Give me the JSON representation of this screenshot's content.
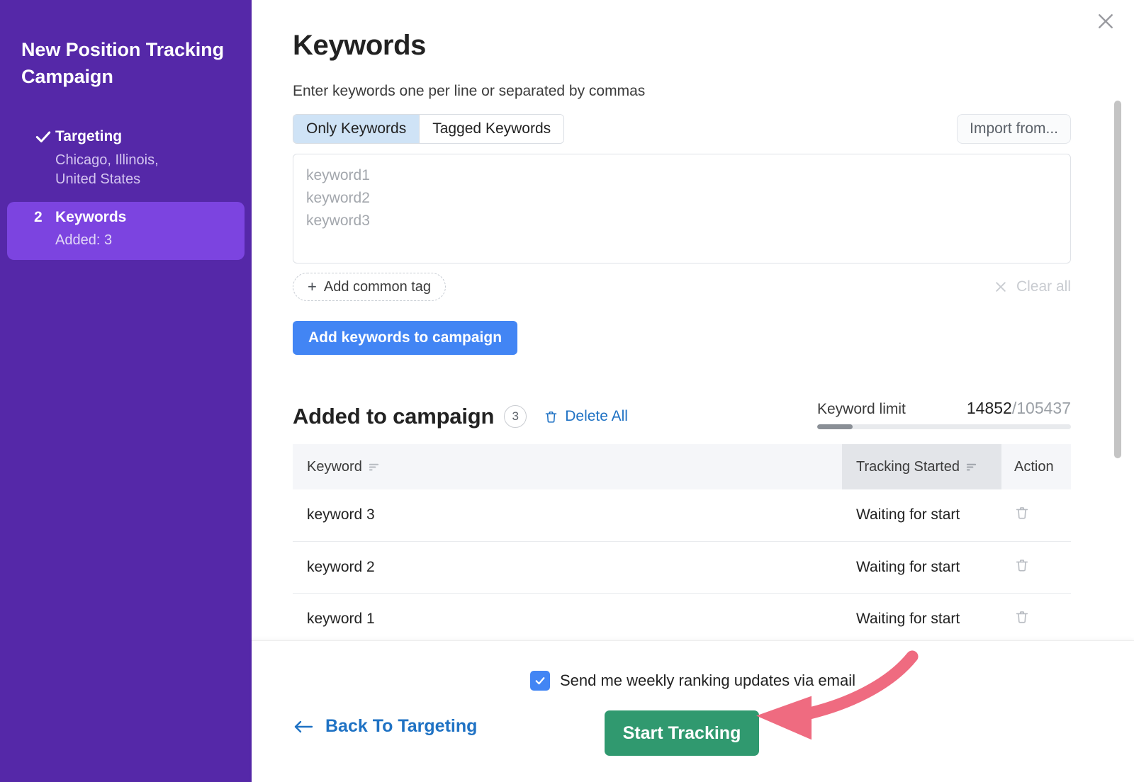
{
  "sidebar": {
    "title": "New Position Tracking Campaign",
    "steps": [
      {
        "marker": "check",
        "label": "Targeting",
        "sub": "Chicago, Illinois, United States",
        "active": false
      },
      {
        "marker": "2",
        "label": "Keywords",
        "sub": "Added: 3",
        "active": true
      }
    ]
  },
  "main": {
    "close_icon": "close-icon",
    "page_title": "Keywords",
    "subtitle": "Enter keywords one per line or separated by commas",
    "tabs": [
      {
        "label": "Only Keywords",
        "active": true
      },
      {
        "label": "Tagged Keywords",
        "active": false
      }
    ],
    "import_button": "Import from...",
    "textarea_placeholder": "keyword1\nkeyword2\nkeyword3",
    "textarea_value": "",
    "add_common_tag": "Add common tag",
    "add_common_tag_plus": "+",
    "clear_all": "Clear all",
    "clear_all_icon": "close-icon",
    "add_keywords_button": "Add keywords to campaign"
  },
  "added": {
    "title": "Added to campaign",
    "count": "3",
    "delete_all": "Delete All",
    "delete_all_icon": "trash-icon"
  },
  "limit": {
    "label": "Keyword limit",
    "used": "14852",
    "separator": "/",
    "total": "105437",
    "percent": 14
  },
  "table": {
    "columns": [
      {
        "label": "Keyword",
        "sort_icon": "sort-icon"
      },
      {
        "label": "Tracking Started",
        "sort_icon": "sort-icon"
      },
      {
        "label": "Action",
        "sort_icon": ""
      }
    ],
    "rows": [
      {
        "keyword": "keyword 3",
        "tracking_started": "Waiting for start",
        "action_icon": "trash-icon"
      },
      {
        "keyword": "keyword 2",
        "tracking_started": "Waiting for start",
        "action_icon": "trash-icon"
      },
      {
        "keyword": "keyword 1",
        "tracking_started": "Waiting for start",
        "action_icon": "trash-icon"
      }
    ]
  },
  "footer": {
    "checkbox_checked": true,
    "checkbox_label": "Send me weekly ranking updates via email",
    "back_link": "Back To Targeting",
    "back_arrow_icon": "arrow-left-icon",
    "start_button": "Start Tracking",
    "annotation_arrow_icon": "pink-curved-arrow-icon"
  },
  "colors": {
    "sidebar_bg": "#5528a8",
    "sidebar_active": "#7c44e0",
    "primary_blue": "#4285f4",
    "link_blue": "#1f72c4",
    "start_green": "#30996f",
    "annotation_pink": "#ef6b80",
    "tab_active": "#cfe3f6"
  }
}
